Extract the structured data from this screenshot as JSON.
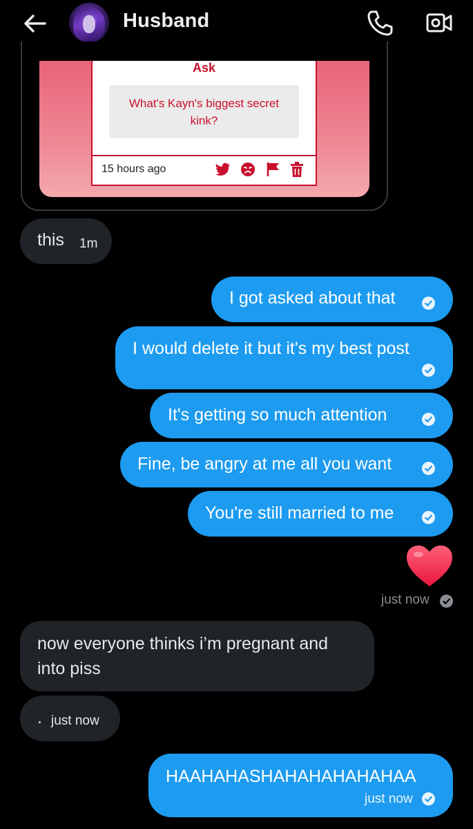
{
  "header": {
    "title": "Husband",
    "back_icon": "arrow-left-icon",
    "call_icon": "phone-icon",
    "video_icon": "video-camera-icon"
  },
  "shared_card": {
    "heading": "Ask",
    "question": "What's Kayn's biggest secret kink?",
    "time": "15 hours ago",
    "icons": [
      "twitter-bird-icon",
      "angry-face-icon",
      "flag-icon",
      "trash-icon"
    ],
    "accent_color": "#c8102e"
  },
  "messages": [
    {
      "id": "m1",
      "side": "in",
      "text": "this",
      "time": "1m"
    },
    {
      "id": "m2",
      "side": "out",
      "text": "I got asked about that",
      "read": true
    },
    {
      "id": "m3",
      "side": "out",
      "text": "I would delete it but it's my best post",
      "read": true
    },
    {
      "id": "m4",
      "side": "out",
      "text": "It's getting so much attention",
      "read": true
    },
    {
      "id": "m5",
      "side": "out",
      "text": "Fine, be angry at me all you want",
      "read": true
    },
    {
      "id": "m6",
      "side": "out",
      "text": "You're still married to me",
      "read": true
    },
    {
      "id": "m7",
      "side": "out",
      "emoji": "❤️",
      "time": "just now",
      "read": true
    },
    {
      "id": "m8",
      "side": "in",
      "lines": [
        "now everyone thinks i’m pregnant and",
        "into piss"
      ]
    },
    {
      "id": "m9",
      "side": "in",
      "text": ".",
      "time": "just now"
    },
    {
      "id": "m10",
      "side": "out",
      "text": "HAAHAHASHAHAHAHAHAHAA",
      "time": "just now",
      "read": true
    }
  ],
  "colors": {
    "outgoing_bubble": "#1d9bf0",
    "incoming_bubble": "#202327",
    "background": "#000000"
  }
}
